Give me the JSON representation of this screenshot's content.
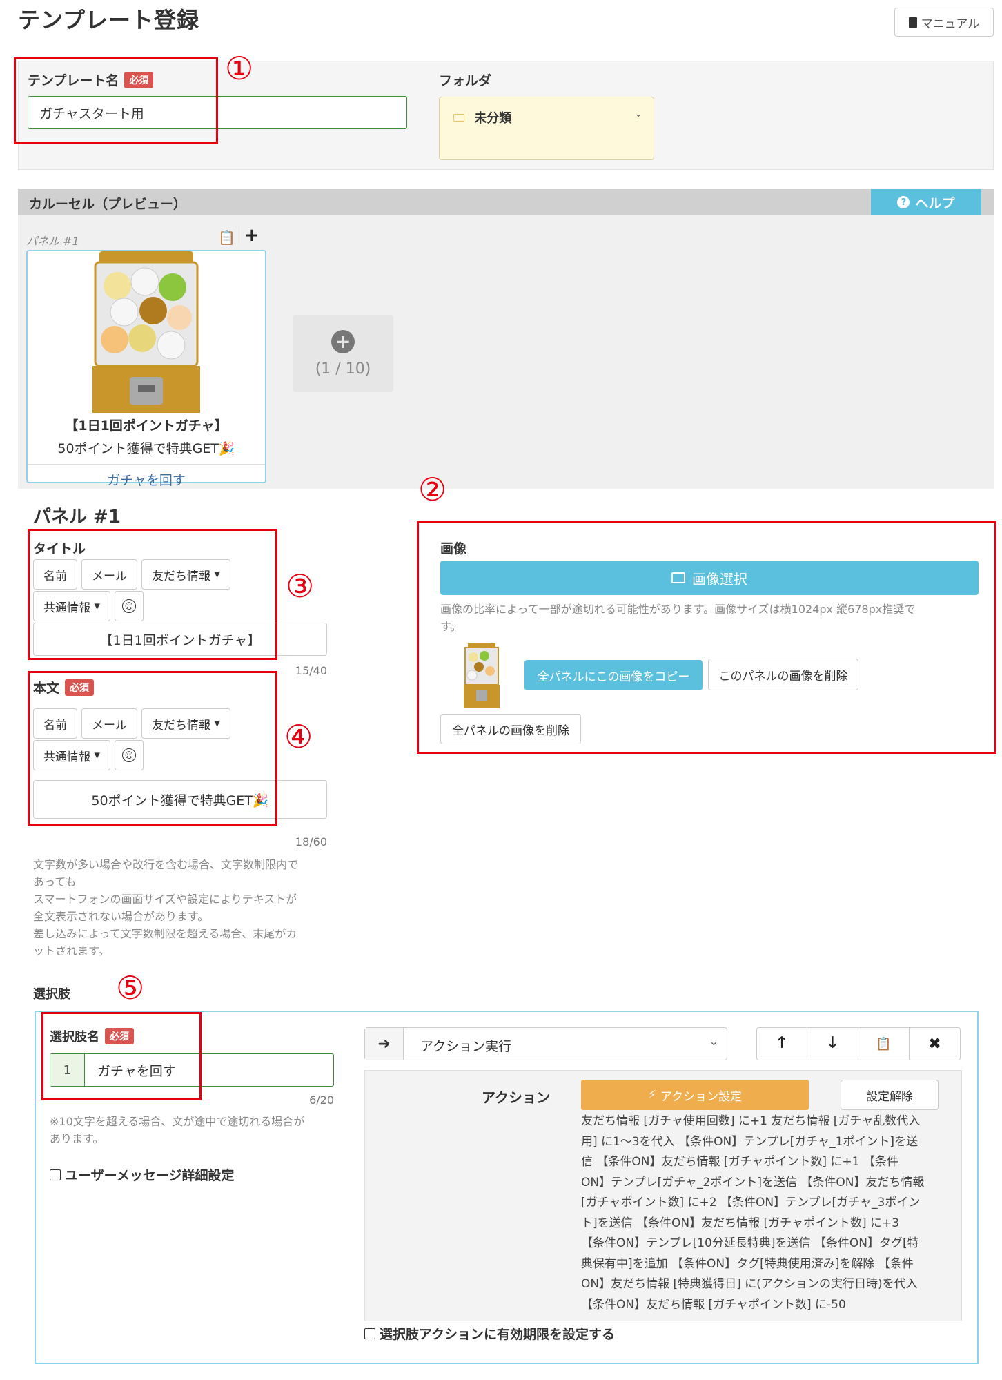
{
  "page": {
    "title": "テンプレート登録",
    "manual_label": "マニュアル"
  },
  "template_name": {
    "label": "テンプレート名",
    "required": "必須",
    "value": "ガチャスタート用"
  },
  "folder": {
    "label": "フォルダ",
    "value": "未分類"
  },
  "annotations": {
    "n1": "①",
    "n2": "②",
    "n3": "③",
    "n4": "④",
    "n5": "⑤",
    "color": "#e60012"
  },
  "carousel": {
    "header": "カルーセル（プレビュー）",
    "help_label": "ヘルプ",
    "panel_label": "パネル #1",
    "card": {
      "title": "【1日1回ポイントガチャ】",
      "text": "50ポイント獲得で特典GET🎉",
      "link": "ガチャを回す"
    },
    "add_counter": "(1 / 10)"
  },
  "panel_edit": {
    "heading": "パネル #1",
    "title_section": {
      "label": "タイトル",
      "buttons": [
        "名前",
        "メール",
        "友だち情報",
        "共通情報"
      ],
      "value": "【1日1回ポイントガチャ】",
      "counter": "15/40"
    },
    "body_section": {
      "label": "本文",
      "required": "必須",
      "buttons": [
        "名前",
        "メール",
        "友だち情報",
        "共通情報"
      ],
      "value": "50ポイント獲得で特典GET🎉",
      "counter": "18/60"
    },
    "note_lines": [
      "文字数が多い場合や改行を含む場合、文字数制限内で",
      "あっても",
      "スマートフォンの画面サイズや設定によりテキストが",
      "全文表示されない場合があります。",
      "差し込みによって文字数制限を超える場合、末尾がカ",
      "ットされます。"
    ]
  },
  "image_section": {
    "label": "画像",
    "select_button": "画像選択",
    "note_line1": "画像の比率によって一部が途切れる可能性があります。画像サイズは横1024px 縦678px推奨で",
    "note_line2": "す。",
    "copy_all": "全パネルにこの画像をコピー",
    "delete_this": "このパネルの画像を削除",
    "delete_all": "全パネルの画像を削除"
  },
  "choices": {
    "label": "選択肢",
    "name_label": "選択肢名",
    "required": "必須",
    "index": "1",
    "name_value": "ガチャを回す",
    "counter": "6/20",
    "note_line1": "※10文字を超える場合、文が途中で途切れる場合が",
    "note_line2": "あります。",
    "user_message_detail": "ユーザーメッセージ詳細設定",
    "action_type": "アクション実行",
    "action_label": "アクション",
    "action_setting": "アクション設定",
    "action_clear": "設定解除",
    "action_lines": [
      "友だち情報 [ガチャ使用回数] に+1 友だち情報 [ガチャ乱数代入",
      "用] に1～3を代入 【条件ON】テンプレ[ガチャ_1ポイント]を送",
      "信 【条件ON】友だち情報 [ガチャポイント数] に+1 【条件",
      "ON】テンプレ[ガチャ_2ポイント]を送信 【条件ON】友だち情報",
      "[ガチャポイント数] に+2 【条件ON】テンプレ[ガチャ_3ポイン",
      "ト]を送信 【条件ON】友だち情報 [ガチャポイント数] に+3",
      "【条件ON】テンプレ[10分延長特典]を送信 【条件ON】タグ[特",
      "典保有中]を追加 【条件ON】タグ[特典使用済み]を解除 【条件",
      "ON】友だち情報 [特典獲得日] に(アクションの実行日時)を代入",
      "【条件ON】友だち情報 [ガチャポイント数] に-50"
    ],
    "expire_label": "選択肢アクションに有効期限を設定する"
  }
}
